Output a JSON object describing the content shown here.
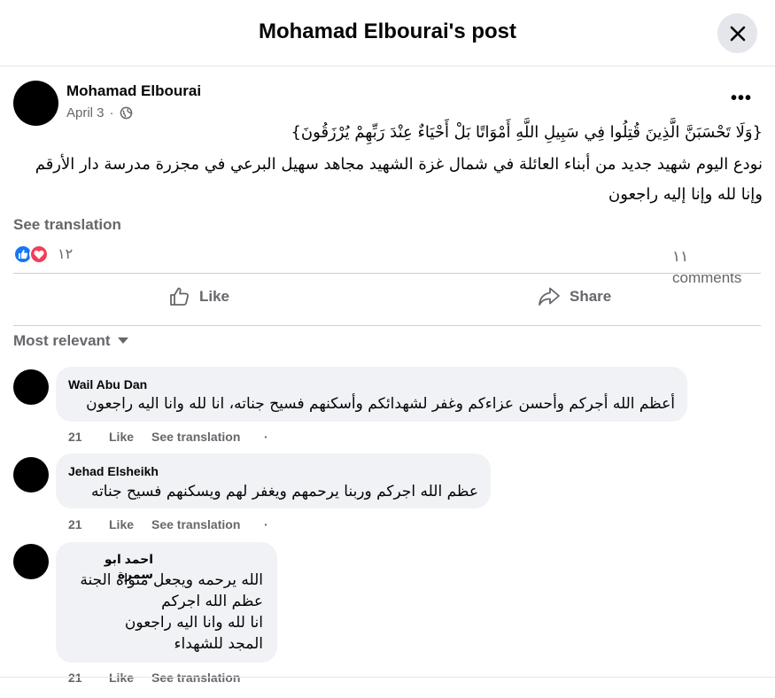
{
  "dialog": {
    "title": "Mohamad Elbourai's post"
  },
  "post": {
    "author": "Mohamad Elbourai",
    "date": "April 3",
    "separator": "·",
    "more_label": "•••",
    "text_lines": [
      "{وَلَا تَحْسَبَنَّ الَّذِينَ قُتِلُوا فِي سَبِيلِ اللَّهِ أَمْوَاتًا بَلْ أَحْيَاءٌ عِنْدَ رَبِّهِمْ يُرْزَقُونَ}",
      "نودع اليوم شهيد جديد من أبناء العائلة في شمال غزة الشهيد مجاهد سهيل البرعي في مجزرة مدرسة دار الأرقم",
      "وإنا لله وإنا إليه راجعون"
    ],
    "see_translation": "See translation",
    "reaction_count": "١٢",
    "comments_count_number": "١١",
    "comments_count_label": "comments"
  },
  "actions": {
    "like": "Like",
    "share": "Share"
  },
  "sort": {
    "label": "Most relevant"
  },
  "comments": [
    {
      "author": "Wail Abu Dan",
      "text": "أعظم الله أجركم وأحسن عزاءكم وغفر لشهدائكم وأسكنهم فسيح جناته، انا لله وانا اليه راجعون",
      "time": "21",
      "like": "Like",
      "translate": "See translation",
      "dot": "·"
    },
    {
      "author": "Jehad Elsheikh",
      "text": "عظم الله اجركم وربنا يرحمهم ويغفر لهم ويسكنهم فسيح جناته",
      "time": "21",
      "like": "Like",
      "translate": "See translation",
      "dot": "·"
    },
    {
      "author": "احمد ابو سمرة",
      "text": "الله يرحمه ويجعل مثواه الجنة\nعظم الله اجركم\nانا لله وانا اليه راجعون\nالمجد للشهداء",
      "time": "21",
      "like": "Like",
      "translate": "See translation"
    }
  ],
  "colors": {
    "like_blue": "#1877f2",
    "love_red": "#f33e58",
    "secondary_text": "#65676b",
    "bubble_bg": "#f0f2f5"
  }
}
